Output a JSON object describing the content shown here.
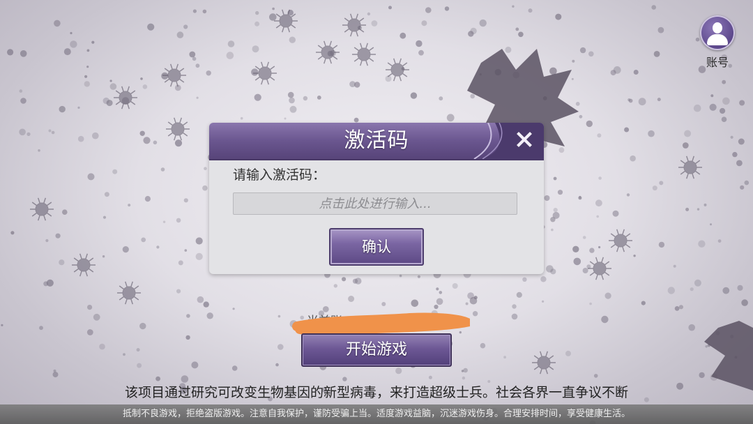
{
  "account": {
    "label": "账号",
    "icon": "user-icon"
  },
  "dialog": {
    "title": "激活码",
    "prompt": "请输入激活码：",
    "input_placeholder": "点击此处进行输入...",
    "input_value": "",
    "confirm_label": "确认",
    "close_icon": "close-icon"
  },
  "main": {
    "current_account_label": "当前账",
    "start_label": "开始游戏",
    "story_text": "该项目通过研究可改变生物基因的新型病毒，来打造超级士兵。社会各界一直争议不断"
  },
  "footer": {
    "health_notice": "抵制不良游戏，拒绝盗版游戏。注意自我保护，谨防受骗上当。适度游戏益脑，沉迷游戏伤身。合理安排时间，享受健康生活。"
  },
  "colors": {
    "accent": "#6a568f",
    "scribble": "#f0924a"
  }
}
